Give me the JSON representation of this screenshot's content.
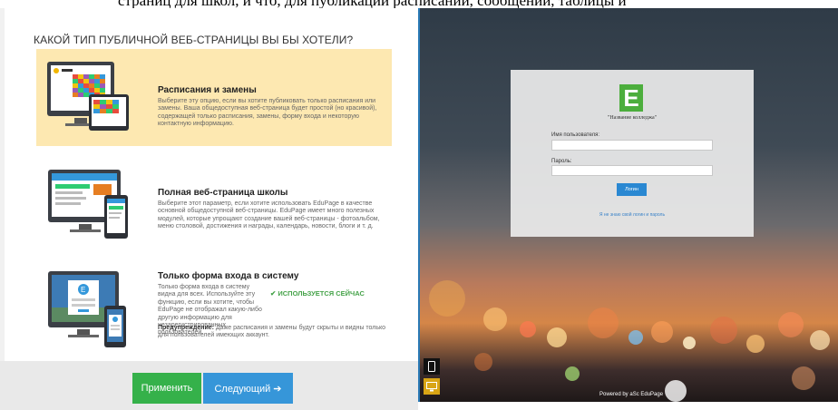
{
  "doc": {
    "caption": "страниц для школ, и что, для публикации расписаний, сообщений, таблицы и"
  },
  "panel": {
    "title": "КАКОЙ ТИП ПУБЛИЧНОЙ ВЕБ-СТРАНИЦЫ ВЫ БЫ ХОТЕЛИ?",
    "options": [
      {
        "title": "Расписания и замены",
        "description": "Выберите эту опцию, если вы хотите публиковать только расписания или замены. Ваша общедоступная веб-страница будет простой (но красивой), содержащей только расписания, замены, форму входа и некоторую контактную информацию.",
        "selected": true
      },
      {
        "title": "Полная веб-страница школы",
        "description": "Выберите этот параметр, если хотите использовать EduPage в качестве основной общедоступной веб-страницы. EduPage имеет много полезных модулей, которые упрощают создание вашей веб-страницы - фотоальбом, меню столовой, достижения и награды, календарь, новости, блоги и т. д.",
        "selected": false
      },
      {
        "title": "Только форма входа в систему",
        "description": "Только форма входа в систему видна для всех. Используйте эту функцию, если вы хотите, чтобы EduPage не отображал какую-либо другую информацию для незарегистрированных пользователей.",
        "status": "✔ ИСПОЛЬЗУЕТСЯ СЕЙЧАС",
        "warning_label": "Предупреждение:",
        "warning_text": " Даже расписания и замены будут скрыты и видны только для пользователей имеющих аккаунт.",
        "selected": false
      }
    ]
  },
  "footer": {
    "apply_label": "Применить",
    "next_label": "Следующий ➔"
  },
  "preview": {
    "logo_letter": "E",
    "college_name": "\"Название колледжа\"",
    "username_label": "Имя пользователя:",
    "password_label": "Пароль:",
    "login_button": "Логин",
    "forgot_link": "Я не знаю свой логин и пароль",
    "powered_by": "Powered by aSc EduPage"
  },
  "colors": {
    "accent_green": "#35b14a",
    "accent_blue": "#3696d9",
    "selected_bg": "#fde8b1",
    "logo_green": "#4cae3d"
  }
}
